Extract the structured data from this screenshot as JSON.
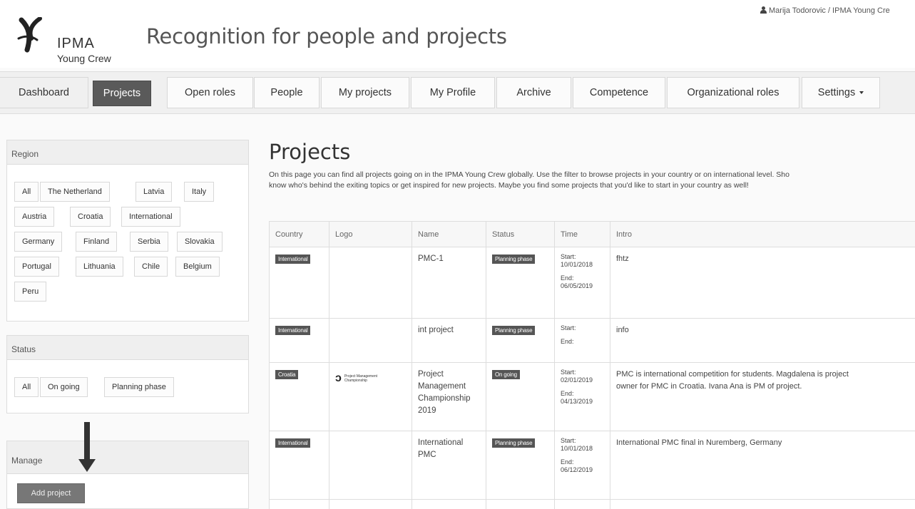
{
  "header": {
    "logo_text": "IPMA",
    "logo_subtext": "Young Crew",
    "app_title": "Recognition for people and projects",
    "user": "Marija Todorovic / IPMA Young Cre"
  },
  "nav": {
    "tabs": [
      {
        "label": "Dashboard"
      },
      {
        "label": "Projects"
      },
      {
        "label": "Open roles"
      },
      {
        "label": "People"
      },
      {
        "label": "My projects"
      },
      {
        "label": "My Profile"
      },
      {
        "label": "Archive"
      },
      {
        "label": "Competence"
      },
      {
        "label": "Organizational roles"
      },
      {
        "label": "Settings"
      }
    ]
  },
  "sidebar": {
    "region": {
      "title": "Region",
      "options": [
        "All",
        "The Netherland",
        "Latvia",
        "Italy",
        "Austria",
        "Croatia",
        "International",
        "Germany",
        "Finland",
        "Serbia",
        "Slovakia",
        "Portugal",
        "Lithuania",
        "Chile",
        "Belgium",
        "Peru"
      ]
    },
    "status": {
      "title": "Status",
      "options": [
        "All",
        "On going",
        "Planning phase"
      ]
    },
    "manage": {
      "title": "Manage",
      "add_button": "Add project"
    }
  },
  "main": {
    "title": "Projects",
    "description_line1": "On this page you can find all projects going on in the IPMA Young Crew globally. Use the filter to browse projects in your country or on international level. Sho",
    "description_line2": "know who's behind the exiting topics or get inspired for new projects. Maybe you find some projects that you'd like to start in your country as well!",
    "table": {
      "columns": [
        "Country",
        "Logo",
        "Name",
        "Status",
        "Time",
        "Intro"
      ],
      "start_label": "Start:",
      "end_label": "End:",
      "rows": [
        {
          "country": "International",
          "name": "PMC-1",
          "status": "Planning phase",
          "start": "10/01/2018",
          "end": "06/05/2019",
          "intro_l1": "fhtz",
          "intro_l2": ""
        },
        {
          "country": "International",
          "name": "int project",
          "status": "Planning phase",
          "start": "",
          "end": "",
          "intro_l1": "info",
          "intro_l2": ""
        },
        {
          "country": "Croatia",
          "name": "Project Management Championship 2019",
          "status": "On going",
          "start": "02/01/2019",
          "end": "04/13/2019",
          "logo_line1": "Project Management",
          "logo_line2": "Championship",
          "intro_l1": "PMC is international competition for students. Magdalena is project",
          "intro_l2": "owner for PMC in Croatia. Ivana Ana is PM of project."
        },
        {
          "country": "International",
          "name": "International PMC",
          "status": "Planning phase",
          "start": "10/01/2018",
          "end": "06/12/2019",
          "intro_l1": "International PMC final in Nuremberg, Germany",
          "intro_l2": ""
        }
      ]
    }
  }
}
